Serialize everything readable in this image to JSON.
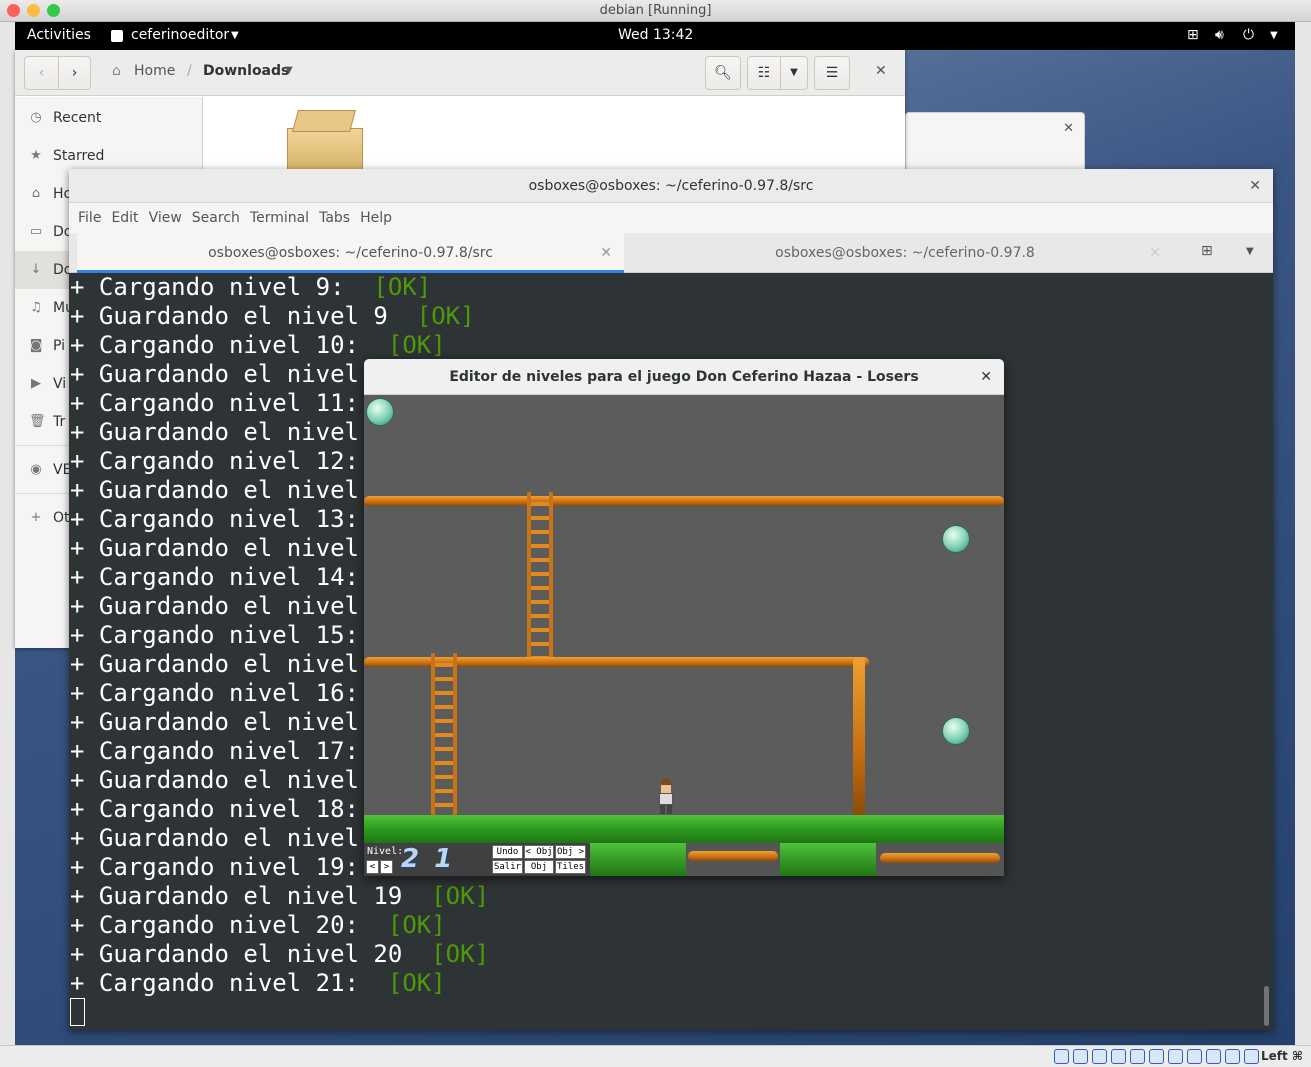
{
  "host_window": {
    "title": "debian [Running]"
  },
  "gnome_bar": {
    "activities": "Activities",
    "app_menu": "ceferinoeditor",
    "clock": "Wed 13:42"
  },
  "files": {
    "path_home": "Home",
    "path_current": "Downloads",
    "sidebar": [
      {
        "label": "Recent",
        "icon": "clock-icon"
      },
      {
        "label": "Starred",
        "icon": "star-icon"
      },
      {
        "label": "Ho",
        "icon": "home-icon"
      },
      {
        "label": "Do",
        "icon": "document-icon"
      },
      {
        "label": "Do",
        "icon": "download-icon"
      },
      {
        "label": "Mu",
        "icon": "music-icon"
      },
      {
        "label": "Pi",
        "icon": "camera-icon"
      },
      {
        "label": "Vi",
        "icon": "video-icon"
      },
      {
        "label": "Tr",
        "icon": "trash-icon"
      },
      {
        "label": "VE",
        "icon": "disc-icon"
      },
      {
        "label": "Ot",
        "icon": "plus-icon"
      }
    ]
  },
  "terminal": {
    "title": "osboxes@osboxes: ~/ceferino-0.97.8/src",
    "menu": [
      "File",
      "Edit",
      "View",
      "Search",
      "Terminal",
      "Tabs",
      "Help"
    ],
    "tabs": [
      "osboxes@osboxes: ~/ceferino-0.97.8/src",
      "osboxes@osboxes: ~/ceferino-0.97.8"
    ],
    "lines": [
      {
        "text": "+ Cargando nivel 9:  ",
        "ok": "[OK]"
      },
      {
        "text": "+ Guardando el nivel 9  ",
        "ok": "[OK]"
      },
      {
        "text": "+ Cargando nivel 10:  ",
        "ok": "[OK]"
      },
      {
        "text": "+ Guardando el nivel",
        "ok": ""
      },
      {
        "text": "+ Cargando nivel 11:",
        "ok": ""
      },
      {
        "text": "+ Guardando el nivel",
        "ok": ""
      },
      {
        "text": "+ Cargando nivel 12:",
        "ok": ""
      },
      {
        "text": "+ Guardando el nivel",
        "ok": ""
      },
      {
        "text": "+ Cargando nivel 13:",
        "ok": ""
      },
      {
        "text": "+ Guardando el nivel",
        "ok": ""
      },
      {
        "text": "+ Cargando nivel 14:",
        "ok": ""
      },
      {
        "text": "+ Guardando el nivel",
        "ok": ""
      },
      {
        "text": "+ Cargando nivel 15:",
        "ok": ""
      },
      {
        "text": "+ Guardando el nivel",
        "ok": ""
      },
      {
        "text": "+ Cargando nivel 16:",
        "ok": ""
      },
      {
        "text": "+ Guardando el nivel",
        "ok": ""
      },
      {
        "text": "+ Cargando nivel 17:",
        "ok": ""
      },
      {
        "text": "+ Guardando el nivel",
        "ok": ""
      },
      {
        "text": "+ Cargando nivel 18:",
        "ok": ""
      },
      {
        "text": "+ Guardando el nivel",
        "ok": ""
      },
      {
        "text": "+ Cargando nivel 19:",
        "ok": ""
      },
      {
        "text": "+ Guardando el nivel 19  ",
        "ok": "[OK]"
      },
      {
        "text": "+ Cargando nivel 20:  ",
        "ok": "[OK]"
      },
      {
        "text": "+ Guardando el nivel 20  ",
        "ok": "[OK]"
      },
      {
        "text": "+ Cargando nivel 21:  ",
        "ok": "[OK]"
      }
    ]
  },
  "editor": {
    "title": "Editor de niveles para el juego Don Ceferino Hazaa - Losers",
    "nivel_label": "Nivel:",
    "nivel_digits": "2 1",
    "buttons": [
      "Undo",
      "< Obj",
      "Obj >",
      "Salir",
      "Obj",
      "Tiles"
    ]
  },
  "vbox": {
    "host_key": "Left ⌘"
  }
}
